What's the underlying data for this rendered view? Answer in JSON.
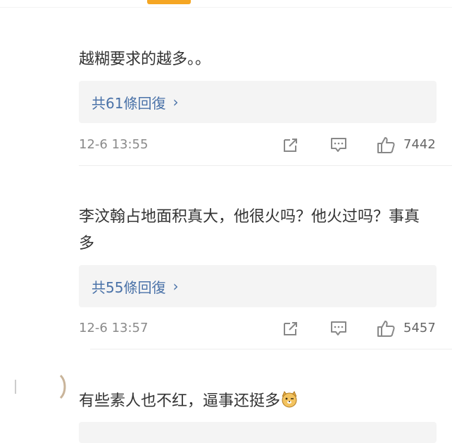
{
  "comments": [
    {
      "text": "越糊要求的越多。。",
      "replies_label": "共61條回復",
      "timestamp": "12-6 13:55",
      "likes": "7442"
    },
    {
      "text": "李汶翰占地面积真大，他很火吗？他火过吗？事真多",
      "replies_label": "共55條回復",
      "timestamp": "12-6 13:57",
      "likes": "5457"
    },
    {
      "text": "有些素人也不红，逼事还挺多"
    }
  ],
  "colors": {
    "accent": "#f5a623",
    "link": "#4a72a8",
    "meta": "#8a8a8a",
    "reply_bg": "#f4f4f4"
  },
  "icons": [
    "share-icon",
    "comment-icon",
    "thumbs-up-icon",
    "doge-emoji"
  ]
}
